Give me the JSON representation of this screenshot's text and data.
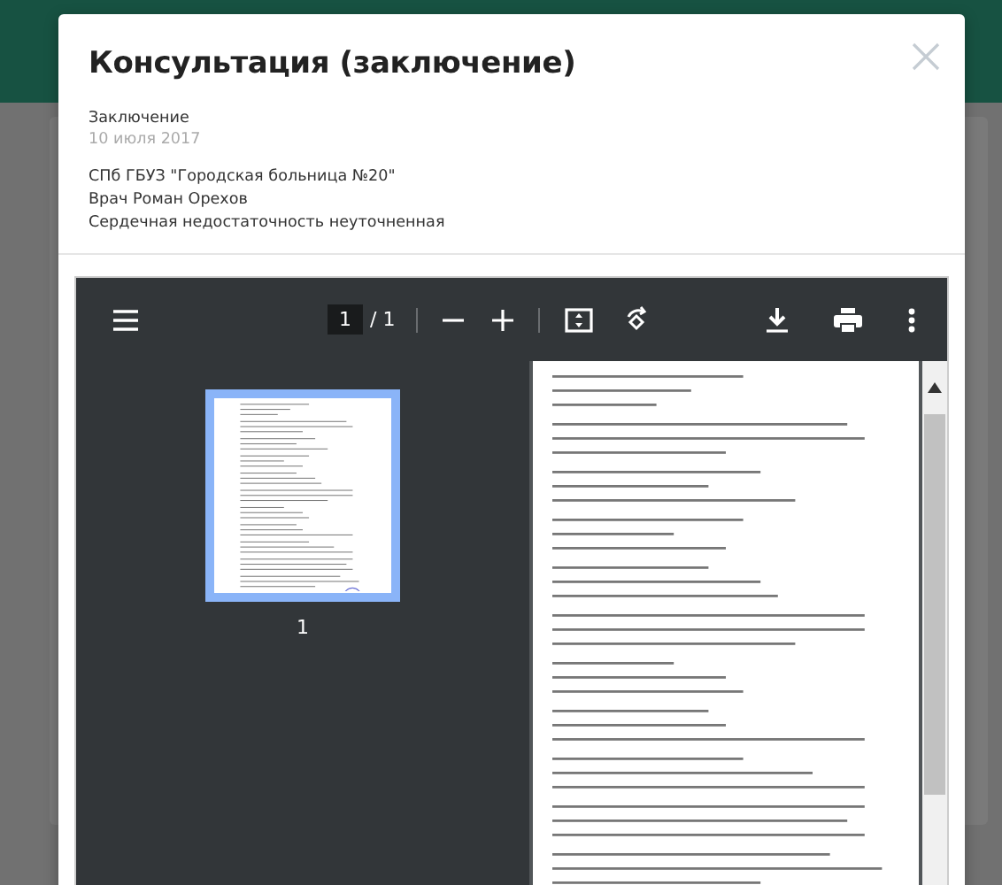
{
  "modal": {
    "title": "Консультация (заключение)",
    "doc_type": "Заключение",
    "date": "10 июля 2017",
    "details": [
      "СПб ГБУЗ \"Городская больница №20\"",
      "Врач Роман Орехов",
      "Сердечная недостаточность неуточненная"
    ]
  },
  "viewer": {
    "page_input": "1",
    "page_total": "/ 1",
    "thumbnails": [
      {
        "label": "1",
        "selected": true
      }
    ]
  }
}
